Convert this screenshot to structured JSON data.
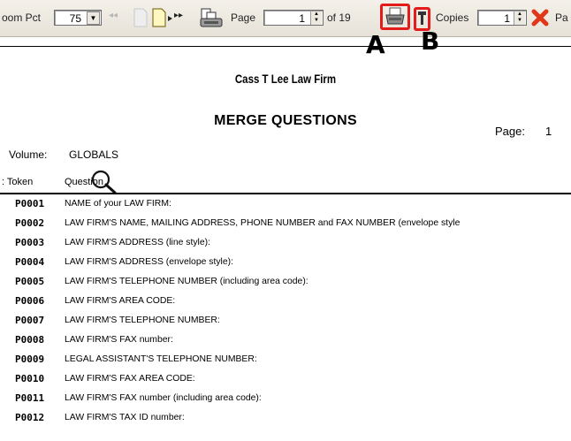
{
  "toolbar": {
    "zoom_label": "oom Pct",
    "zoom_value": "75",
    "page_label": "Page",
    "page_value": "1",
    "of_label": "of 19",
    "copies_label": "Copies",
    "copies_value": "1",
    "trailing_label": "Pa",
    "nav_prev_glyph": "◂◂",
    "nav_next_glyph": "▸▸",
    "icons": [
      "first-page-icon",
      "page-icon",
      "next-page-icon",
      "last-page-icon",
      "zoom-pages-icon",
      "printer-icon",
      "collate-icon",
      "close-icon"
    ],
    "highlight_color": "#e41b1b"
  },
  "callouts": {
    "a": "A",
    "b": "B"
  },
  "report": {
    "firm": "Cass T Lee Law Firm",
    "title": "MERGE QUESTIONS",
    "page_label": "Page:",
    "page_number": "1",
    "volume_label": "Volume:",
    "volume_value": "GLOBALS",
    "col_token": ": Token",
    "col_question": "Question"
  },
  "rows": [
    {
      "token": "P0001",
      "question": "NAME of your LAW FIRM:"
    },
    {
      "token": "P0002",
      "question": "LAW FIRM'S NAME, MAILING ADDRESS, PHONE NUMBER and FAX NUMBER (envelope style"
    },
    {
      "token": "P0003",
      "question": "LAW FIRM'S ADDRESS (line style):"
    },
    {
      "token": "P0004",
      "question": "LAW FIRM'S ADDRESS (envelope style):"
    },
    {
      "token": "P0005",
      "question": "LAW FIRM'S TELEPHONE NUMBER (including area code):"
    },
    {
      "token": "P0006",
      "question": "LAW FIRM'S AREA CODE:"
    },
    {
      "token": "P0007",
      "question": "LAW FIRM'S TELEPHONE NUMBER:"
    },
    {
      "token": "P0008",
      "question": "LAW FIRM'S FAX number:"
    },
    {
      "token": "P0009",
      "question": "LEGAL ASSISTANT'S TELEPHONE NUMBER:"
    },
    {
      "token": "P0010",
      "question": "LAW FIRM'S FAX AREA CODE:"
    },
    {
      "token": "P0011",
      "question": "LAW FIRM'S FAX number (including area code):"
    },
    {
      "token": "P0012",
      "question": "LAW FIRM'S TAX ID number:"
    }
  ]
}
